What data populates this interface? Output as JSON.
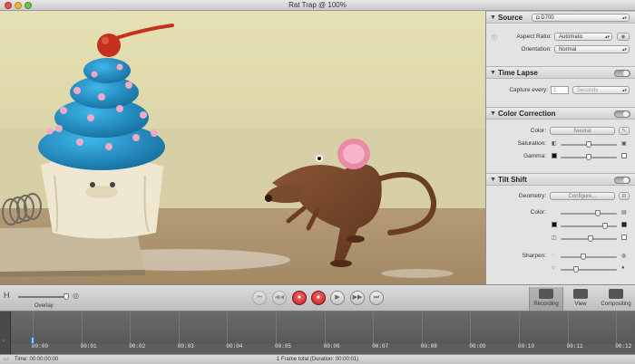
{
  "window": {
    "title": "Rat Trap @ 100%"
  },
  "inspector": {
    "source": {
      "title": "Source",
      "camera": "D700",
      "aspect_ratio_label": "Aspect Ratio:",
      "aspect_ratio_value": "Automatic",
      "orientation_label": "Orientation:",
      "orientation_value": "Normal"
    },
    "time_lapse": {
      "title": "Time Lapse",
      "capture_every_label": "Capture every:",
      "capture_every_value": "1",
      "capture_unit": "Seconds"
    },
    "color_correction": {
      "title": "Color Correction",
      "color_label": "Color:",
      "color_value": "Neutral",
      "saturation_label": "Saturation:",
      "gamma_label": "Gamma:"
    },
    "tilt_shift": {
      "title": "Tilt Shift",
      "geometry_label": "Geometry:",
      "geometry_button": "Configure...",
      "color_label": "Color:",
      "sharpen_label": "Sharpen:"
    }
  },
  "toolbar": {
    "overlay_label": "Overlay",
    "recording_label": "Recording",
    "view_label": "View",
    "compositing_label": "Compositing"
  },
  "timeline": {
    "ticks": [
      "00:00",
      "00:01",
      "00:02",
      "00:03",
      "00:04",
      "00:05",
      "00:06",
      "00:07",
      "00:08",
      "00:09",
      "00:10",
      "00:11",
      "00:12"
    ]
  },
  "status": {
    "time": "Time: 00:00:00:00",
    "frames": "1 Frame total (Duration: 00:00:01)"
  },
  "icons": {
    "source_camera": "camera-icon",
    "rewind": "rewind-icon",
    "record": "record-icon",
    "play": "play-icon",
    "fast_forward": "fast-forward-icon"
  },
  "colors": {
    "record_red": "#d42a2a",
    "timeline_bg": "#5d5d5d"
  }
}
